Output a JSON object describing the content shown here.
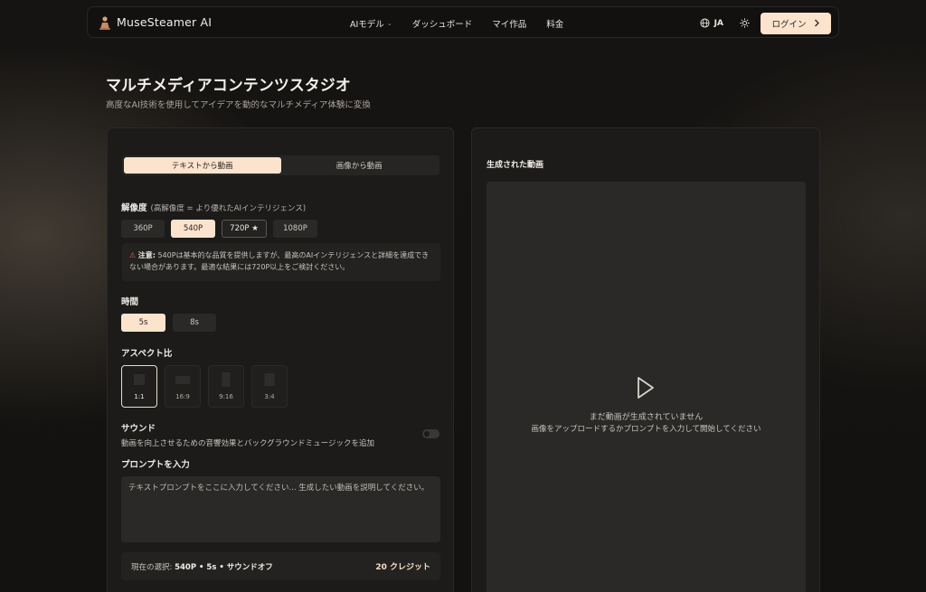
{
  "nav": {
    "brand": "MuseSteamer AI",
    "links": [
      {
        "label": "AIモデル",
        "dropdown": true
      },
      {
        "label": "ダッシュボード"
      },
      {
        "label": "マイ作品"
      },
      {
        "label": "料金"
      }
    ],
    "language": "JA",
    "login_label": "ログイン"
  },
  "header": {
    "title": "マルチメディアコンテンツスタジオ",
    "subtitle": "高度なAI技術を使用してアイデアを動的なマルチメディア体験に変換"
  },
  "form": {
    "tabs": [
      {
        "label": "テキストから動画",
        "active": true
      },
      {
        "label": "画像から動画",
        "active": false
      }
    ],
    "resolution": {
      "label": "解像度",
      "hint": "(高解像度 = より優れたAIインテリジェンス)",
      "options": [
        {
          "label": "360P",
          "state": "default"
        },
        {
          "label": "540P",
          "state": "active"
        },
        {
          "label": "720P ★",
          "state": "outlined"
        },
        {
          "label": "1080P",
          "state": "default"
        }
      ],
      "notice_prefix": "注意:",
      "notice_text": "540Pは基本的な品質を提供しますが、最高のAIインテリジェンスと詳細を達成できない場合があります。最適な結果には720P以上をご検討ください。"
    },
    "duration": {
      "label": "時間",
      "options": [
        {
          "label": "5s",
          "state": "active"
        },
        {
          "label": "8s",
          "state": "default"
        }
      ]
    },
    "aspect": {
      "label": "アスペクト比",
      "options": [
        {
          "label": "1:1",
          "active": true
        },
        {
          "label": "16:9",
          "active": false
        },
        {
          "label": "9:16",
          "active": false
        },
        {
          "label": "3:4",
          "active": false
        }
      ]
    },
    "sound": {
      "label": "サウンド",
      "description": "動画を向上させるための音響効果とバックグラウンドミュージックを追加",
      "enabled": false
    },
    "prompt": {
      "label": "プロンプトを入力",
      "placeholder": "テキストプロンプトをここに入力してください... 生成したい動画を説明してください。",
      "value": ""
    },
    "summary": {
      "prefix": "現在の選択:",
      "selection": "540P • 5s • サウンドオフ",
      "credits": "20 クレジット"
    }
  },
  "output": {
    "title": "生成された動画",
    "empty_title": "まだ動画が生成されていません",
    "empty_hint": "画像をアップロードするかプロンプトを入力して開始してください"
  },
  "colors": {
    "accent": "#fbe3cd",
    "panel": "#1c1b1a",
    "warning": "#e0645a"
  }
}
